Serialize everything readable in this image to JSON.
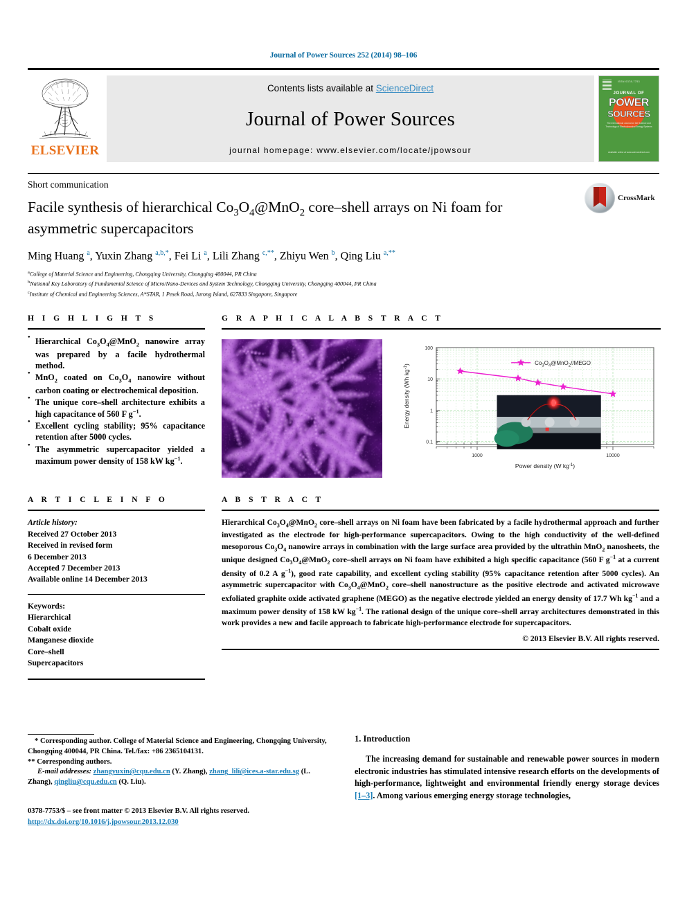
{
  "running_head": "Journal of Power Sources 252 (2014) 98–106",
  "masthead": {
    "contents_prefix": "Contents lists available at ",
    "sciencedirect": "ScienceDirect",
    "journal_title": "Journal of Power Sources",
    "homepage": "journal homepage: www.elsevier.com/locate/jpowsour",
    "publisher": "ELSEVIER",
    "cover": {
      "top_line": "ISSN 0378-7753",
      "journal_of": "JOURNAL OF",
      "power": "POWER",
      "sources": "SOURCES",
      "blurb": "The International Journal on the Science and Technology of Electrochemical Energy Systems",
      "foot": "Available online at\nwww.sciencedirect.com"
    },
    "link_color": "#3c8fc4"
  },
  "article": {
    "category": "Short communication",
    "title_html": "Facile synthesis of hierarchical Co<sub>3</sub>O<sub>4</sub>@MnO<sub>2</sub> core–shell arrays on Ni foam for asymmetric supercapacitors",
    "authors_html": "Ming Huang <sup>a</sup>, Yuxin Zhang <sup>a,b,</sup><sup>*</sup>, Fei Li <sup>a</sup>, Lili Zhang <sup>c,</sup><sup>**</sup>, Zhiyu Wen <sup>b</sup>, Qing Liu <sup>a,</sup><sup>**</sup>",
    "crossmark_label": "CrossMark",
    "affiliations": [
      "College of Material Science and Engineering, Chongqing University, Chongqing 400044, PR China",
      "National Key Laboratory of Fundamental Science of Micro/Nano-Devices and System Technology, Chongqing University, Chongqing 400044, PR China",
      "Institute of Chemical and Engineering Sciences, A*STAR, 1 Pesek Road, Jurong Island, 627833 Singapore, Singapore"
    ],
    "affiliation_marks": [
      "a",
      "b",
      "c"
    ]
  },
  "highlights": {
    "heading": "H I G H L I G H T S",
    "items_html": [
      "Hierarchical Co<sub>3</sub>O<sub>4</sub>@MnO<sub>2</sub> nanowire array was prepared by a facile hydrothermal method.",
      "MnO<sub>2</sub> coated on Co<sub>3</sub>O<sub>4</sub> nanowire without carbon coating or electrochemical deposition.",
      "The unique core–shell architecture exhibits a high capacitance of 560 F g<sup>−1</sup>.",
      "Excellent cycling stability; 95% capacitance retention after 5000 cycles.",
      "The asymmetric supercapacitor yielded a maximum power density of 158 kW kg<sup>−1</sup>."
    ]
  },
  "graphical_abstract": {
    "heading": "G R A P H I C A L   A B S T R A C T",
    "sem_image_alt": "SEM micrograph of purple Co3O4@MnO2 nanowire arrays"
  },
  "chart_data": {
    "type": "line",
    "title": "",
    "xlabel_html": "Power density (W kg<sup>-1</sup>)",
    "ylabel_html": "Energy density (Wh kg<sup>-1</sup>)",
    "xlabel": "Power density (W kg-1)",
    "ylabel": "Energy density (Wh kg-1)",
    "xscale": "log",
    "yscale": "log",
    "xlim": [
      500,
      20000
    ],
    "ylim": [
      0.08,
      100
    ],
    "xticks": [
      1000,
      10000
    ],
    "xtick_labels": [
      "1000",
      "10000"
    ],
    "yticks": [
      0.1,
      1,
      10,
      100
    ],
    "ytick_labels": [
      "0.1",
      "1",
      "10",
      "100"
    ],
    "grid": true,
    "grid_color": "#bfe8bf",
    "legend_position": "top-right",
    "series": [
      {
        "name_html": "Co<sub>3</sub>O<sub>4</sub>@MnO<sub>2</sub>//MEGO",
        "name": "Co3O4@MnO2//MEGO",
        "color": "#ec20d0",
        "marker": "star",
        "x": [
          750,
          2000,
          2800,
          4300,
          10000
        ],
        "y": [
          17.7,
          10.5,
          7.6,
          5.6,
          3.3
        ]
      }
    ],
    "inset_caption": "Photograph of a red LED powered by the asymmetric supercapacitor device"
  },
  "article_info": {
    "heading": "A R T I C L E   I N F O",
    "history_label": "Article history:",
    "history": [
      "Received 27 October 2013",
      "Received in revised form",
      "6 December 2013",
      "Accepted 7 December 2013",
      "Available online 14 December 2013"
    ],
    "keywords_label": "Keywords:",
    "keywords": [
      "Hierarchical",
      "Cobalt oxide",
      "Manganese dioxide",
      "Core–shell",
      "Supercapacitors"
    ]
  },
  "abstract": {
    "heading": "A B S T R A C T",
    "text_html": "Hierarchical Co<sub>3</sub>O<sub>4</sub>@MnO<sub>2</sub> core–shell arrays on Ni foam have been fabricated by a facile hydrothermal approach and further investigated as the electrode for high-performance supercapacitors. Owing to the high conductivity of the well-defined mesoporous Co<sub>3</sub>O<sub>4</sub> nanowire arrays in combination with the large surface area provided by the ultrathin MnO<sub>2</sub> nanosheets, the unique designed Co<sub>3</sub>O<sub>4</sub>@MnO<sub>2</sub> core–shell arrays on Ni foam have exhibited a high specific capacitance (560 F g<sup>−1</sup> at a current density of 0.2 A g<sup>−1</sup>), good rate capability, and excellent cycling stability (95% capacitance retention after 5000 cycles). An asymmetric supercapacitor with Co<sub>3</sub>O<sub>4</sub>@MnO<sub>2</sub> core–shell nanostructure as the positive electrode and activated microwave exfoliated graphite oxide activated graphene (MEGO) as the negative electrode yielded an energy density of 17.7 Wh kg<sup>−1</sup> and a maximum power density of 158 kW kg<sup>−1</sup>. The rational design of the unique core–shell array architectures demonstrated in this work provides a new and facile approach to fabricate high-performance electrode for supercapacitors.",
    "copyright": "© 2013 Elsevier B.V. All rights reserved."
  },
  "footnotes": {
    "star_note": "* Corresponding author. College of Material Science and Engineering, Chongqing University, Chongqing 400044, PR China. Tel./fax: +86 2365104131.",
    "dstar_note": "** Corresponding authors.",
    "email_label": "E-mail addresses:",
    "emails": [
      {
        "address": "zhangyuxin@cqu.edu.cn",
        "who": "(Y. Zhang)"
      },
      {
        "address": "zhang_lili@ices.a-star.edu.sg",
        "who": "(L. Zhang)"
      },
      {
        "address": "qingliu@cqu.edu.cn",
        "who": "(Q. Liu)"
      }
    ],
    "frontmatter": "0378-7753/$ – see front matter © 2013 Elsevier B.V. All rights reserved.",
    "doi": "http://dx.doi.org/10.1016/j.jpowsour.2013.12.030"
  },
  "introduction": {
    "heading": "1. Introduction",
    "paragraph_pre": "The increasing demand for sustainable and renewable power sources in modern electronic industries has stimulated intensive research efforts on the developments of high-performance, lightweight and environmental friendly energy storage devices ",
    "reference": "[1–3]",
    "paragraph_post": ". Among various emerging energy storage technologies,"
  }
}
